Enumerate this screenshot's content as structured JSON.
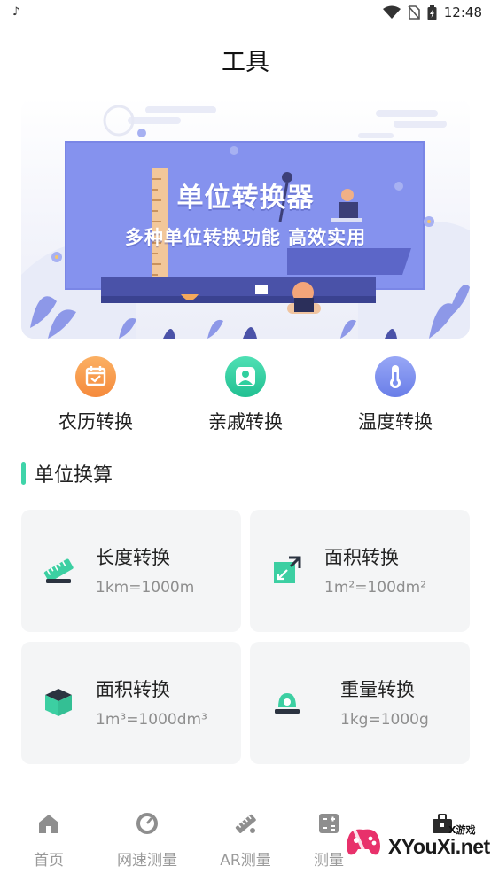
{
  "status_bar": {
    "time": "12:48"
  },
  "header": {
    "title": "工具"
  },
  "banner": {
    "title": "单位转换器",
    "subtitle": "多种单位转换功能  高效实用"
  },
  "quick_tools": [
    {
      "label": "农历转换",
      "icon": "calendar-icon",
      "color": "#f79a45"
    },
    {
      "label": "亲戚转换",
      "icon": "person-icon",
      "color": "#2fcf9e"
    },
    {
      "label": "温度转换",
      "icon": "thermometer-icon",
      "color": "#7a8ff0"
    }
  ],
  "section": {
    "title": "单位换算"
  },
  "cards": [
    {
      "title": "长度转换",
      "subtitle": "1km=1000m",
      "icon": "ruler-icon"
    },
    {
      "title": "面积转换",
      "subtitle": "1m²=100dm²",
      "icon": "expand-icon"
    },
    {
      "title": "面积转换",
      "subtitle": "1m³=1000dm³",
      "icon": "cube-icon"
    },
    {
      "title": "重量转换",
      "subtitle": "1kg=1000g",
      "icon": "scale-icon"
    }
  ],
  "bottom_nav": [
    {
      "label": "首页",
      "icon": "home-icon"
    },
    {
      "label": "网速测量",
      "icon": "speedometer-icon"
    },
    {
      "label": "AR测量",
      "icon": "ar-ruler-icon"
    },
    {
      "label": "测量",
      "icon": "calculator-icon"
    },
    {
      "label": "",
      "icon": "toolbox-icon"
    }
  ],
  "watermark": {
    "text": "XYouXi.net",
    "small_text": "X游戏"
  },
  "colors": {
    "accent": "#3fd4a9",
    "card_bg": "#f4f5f6",
    "banner_panel": "#8592ee",
    "muted_text": "#8e8e8e"
  }
}
